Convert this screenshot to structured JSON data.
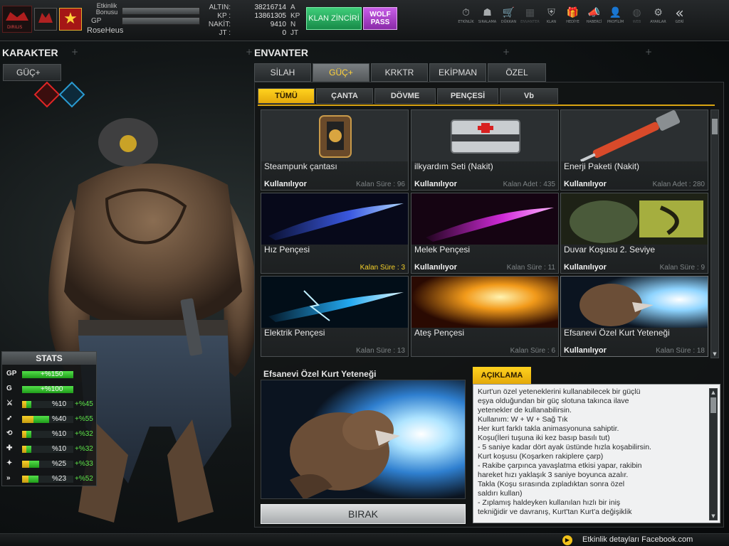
{
  "topbar": {
    "etkinlik_label": "Etkinlik Bonusu",
    "gp_label": "GP",
    "username": "RoseHeus",
    "currencies": [
      {
        "key": "ALTIN:",
        "value": "38216714",
        "unit": "A"
      },
      {
        "key": "KP :",
        "value": "13861305",
        "unit": "KP"
      },
      {
        "key": "NAKİT:",
        "value": "9410",
        "unit": "N"
      },
      {
        "key": "JT :",
        "value": "0",
        "unit": "JT"
      }
    ],
    "klan_button": "KLAN ZİNCİRİ",
    "wolf_button_line1": "WOLF",
    "wolf_button_line2": "PASS",
    "nav": [
      {
        "label": "ETKİNLİK",
        "icon": "⏱"
      },
      {
        "label": "SIRALAMA",
        "icon": "☗"
      },
      {
        "label": "DÜKKAN",
        "icon": "🛒"
      },
      {
        "label": "ENVANTER",
        "icon": "▦"
      },
      {
        "label": "KLAN",
        "icon": "⛨"
      },
      {
        "label": "HEDİYE",
        "icon": "🎁"
      },
      {
        "label": "HABERCİ",
        "icon": "📣"
      },
      {
        "label": "PROFİLİM",
        "icon": "👤"
      },
      {
        "label": "WEB",
        "icon": "◍"
      },
      {
        "label": "AYARLAR",
        "icon": "⚙"
      },
      {
        "label": "GERİ",
        "icon": "«"
      }
    ]
  },
  "karakter": {
    "title": "KARAKTER",
    "guc_button": "GÜÇ+"
  },
  "stats": {
    "title": "STATS",
    "rows": [
      {
        "icon": "GP",
        "value": "+%150",
        "bonus": "",
        "yellow": 0,
        "green": 1.0
      },
      {
        "icon": "G",
        "value": "+%100",
        "bonus": "",
        "yellow": 0,
        "green": 1.0
      },
      {
        "icon": "⚔",
        "value": "%10",
        "bonus": "+%45",
        "yellow": 0.08,
        "green": 0.1
      },
      {
        "icon": "➶",
        "value": "%40",
        "bonus": "+%55",
        "yellow": 0.22,
        "green": 0.3
      },
      {
        "icon": "⟲",
        "value": "%10",
        "bonus": "+%32",
        "yellow": 0.08,
        "green": 0.1
      },
      {
        "icon": "✚",
        "value": "%10",
        "bonus": "+%32",
        "yellow": 0.08,
        "green": 0.1
      },
      {
        "icon": "✦",
        "value": "%25",
        "bonus": "+%33",
        "yellow": 0.14,
        "green": 0.2
      },
      {
        "icon": "»",
        "value": "%23",
        "bonus": "+%52",
        "yellow": 0.12,
        "green": 0.2
      }
    ]
  },
  "envanter": {
    "title": "ENVANTER",
    "main_tabs": [
      "SİLAH",
      "GÜÇ+",
      "KRKTR",
      "EKİPMAN",
      "ÖZEL"
    ],
    "active_main_tab": 1,
    "sub_tabs": [
      "TÜMÜ",
      "ÇANTA",
      "DÖVME",
      "PENÇESİ",
      "Vb"
    ],
    "active_sub_tab": 0,
    "items": [
      {
        "name": "Steampunk çantası",
        "status": "Kullanılıyor",
        "remain": "Kalan Süre : 96",
        "hot": false,
        "art": "bag"
      },
      {
        "name": "ilkyardım Seti (Nakit)",
        "status": "Kullanılıyor",
        "remain": "Kalan Adet : 435",
        "hot": false,
        "art": "medkit"
      },
      {
        "name": "Enerji Paketi (Nakit)",
        "status": "Kullanılıyor",
        "remain": "Kalan Adet : 280",
        "hot": false,
        "art": "syringe"
      },
      {
        "name": "Hız Pençesi",
        "status": "",
        "remain": "Kalan Süre : 3",
        "hot": true,
        "art": "blue-claw"
      },
      {
        "name": "Melek Pençesi",
        "status": "Kullanılıyor",
        "remain": "Kalan Süre : 11",
        "hot": false,
        "art": "pink-claw"
      },
      {
        "name": "Duvar Koşusu 2. Seviye",
        "status": "Kullanılıyor",
        "remain": "Kalan Süre : 9",
        "hot": false,
        "art": "wolf-wall"
      },
      {
        "name": "Elektrik Pençesi",
        "status": "",
        "remain": "Kalan Süre : 13",
        "hot": false,
        "art": "elec-claw"
      },
      {
        "name": "Ateş Pençesi",
        "status": "",
        "remain": "Kalan Süre : 6",
        "hot": false,
        "art": "fire-claw"
      },
      {
        "name": "Efsanevi Özel Kurt Yeteneği",
        "status": "Kullanılıyor",
        "remain": "Kalan Süre : 18",
        "hot": false,
        "art": "wolf-blast"
      }
    ]
  },
  "detail": {
    "title": "Efsanevi Özel Kurt Yeteneği",
    "drop_button": "BIRAK",
    "desc_tab": "AÇIKLAMA",
    "desc_lines": [
      "Kurt'un özel yeteneklerini kullanabilecek bir güçlü",
      "eşya olduğundan bir güç slotuna takınca ilave",
      "yetenekler de kullanabilirsin.",
      "Kullanım: W + W + Sağ Tık",
      "Her kurt farklı takla animasyonuna sahiptir.",
      "Koşu(İleri tuşuna iki kez basıp basılı tut)",
      "- 5 saniye kadar dört ayak üstünde hızla koşabilirsin.",
      "Kurt koşusu (Koşarken rakiplere çarp)",
      "- Rakibe çarpınca yavaşlatma etkisi yapar, rakibin",
      "  hareket hızı yaklaşık 3 saniye boyunca azalır.",
      "Takla (Koşu sırasında zıpladıktan sonra özel",
      "saldırı kullan)",
      "- Zıplamış haldeyken kullanılan hızlı bir iniş",
      "  tekniğidir ve davranış, Kurt'tan Kurt'a değişiklik"
    ]
  },
  "footer": {
    "text": "Etkinlik detayları Facebook.com"
  }
}
